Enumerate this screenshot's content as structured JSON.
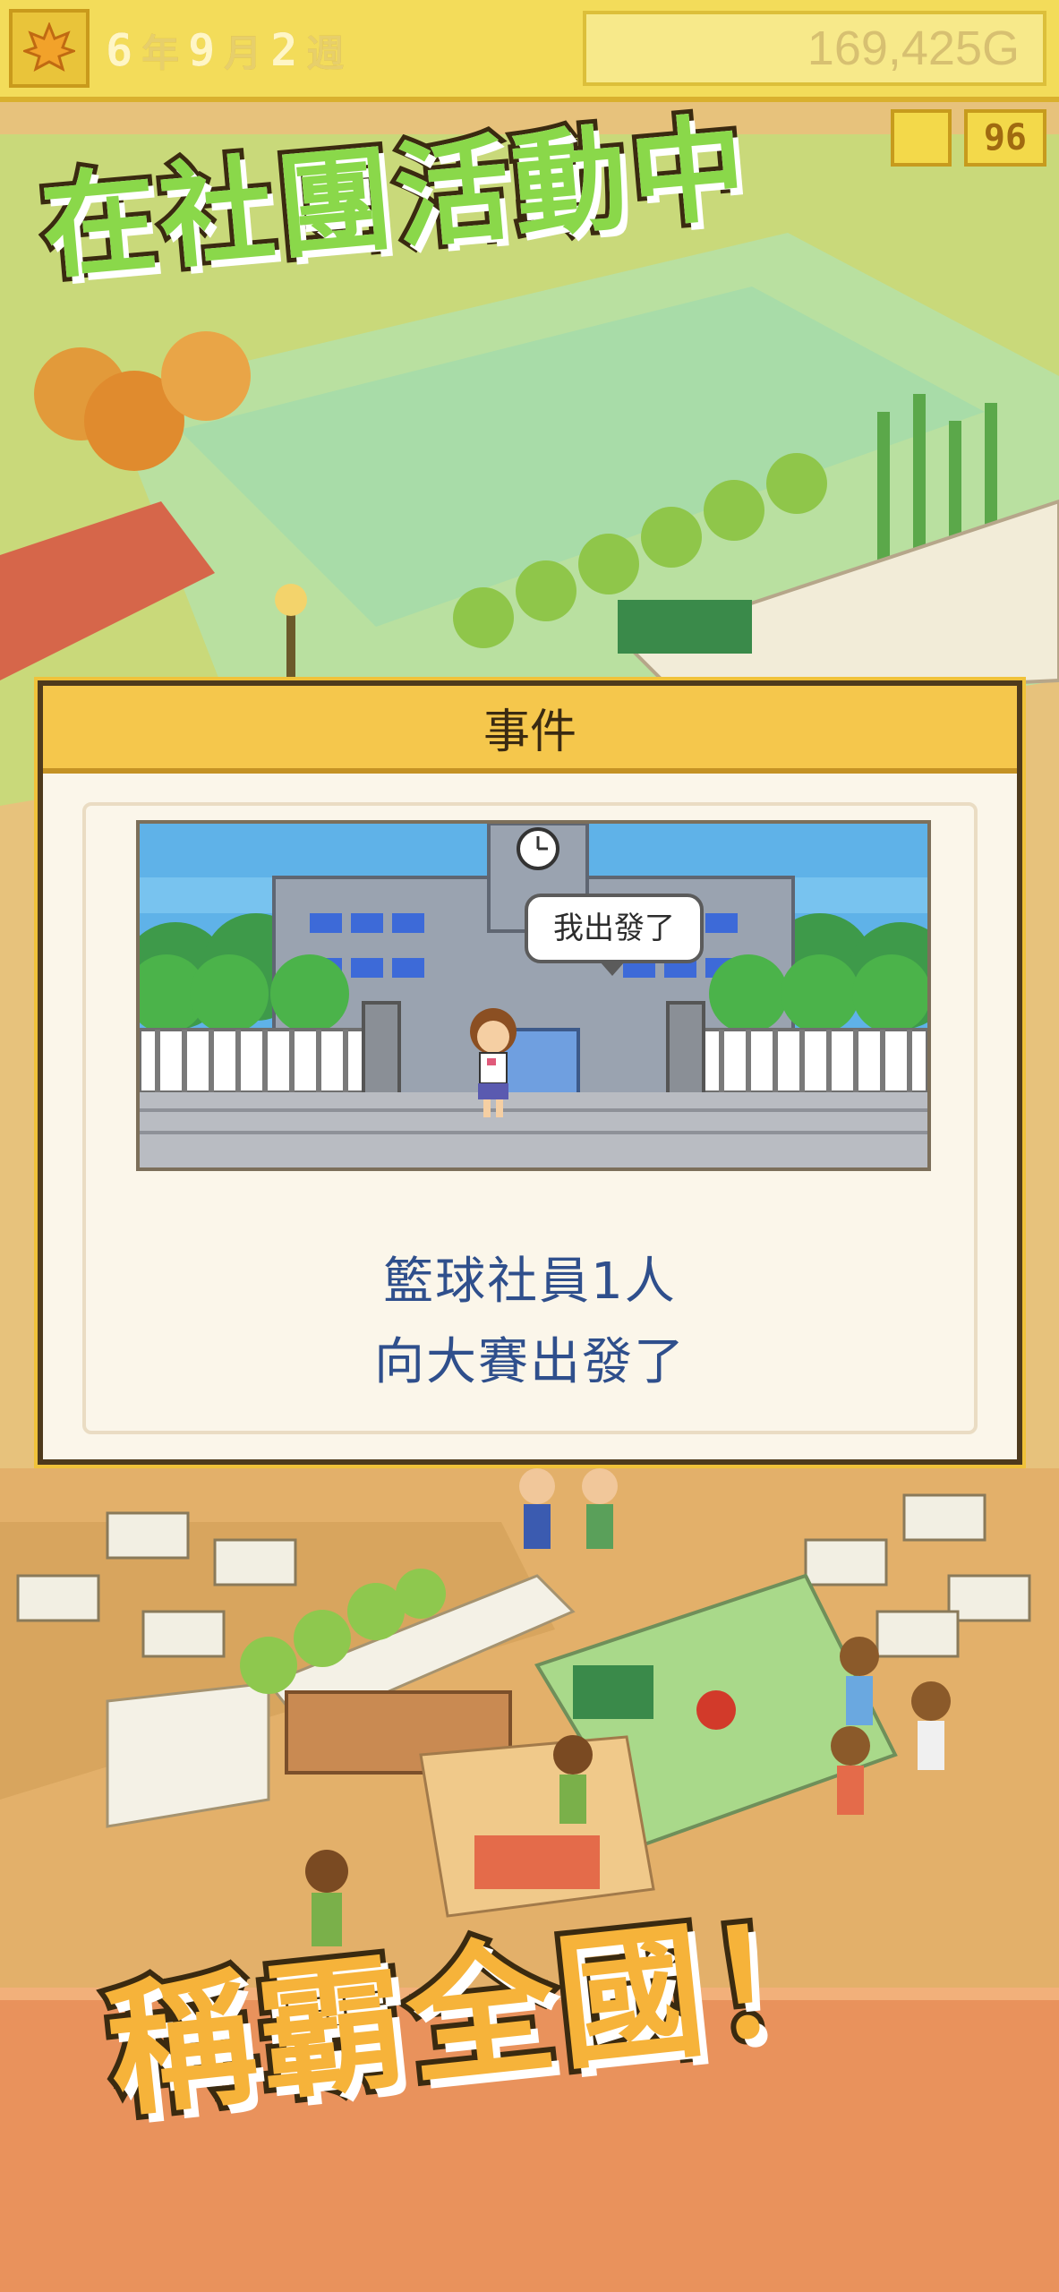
{
  "hud": {
    "season_icon": "maple-leaf-icon",
    "year": "6",
    "year_unit": "年",
    "month": "9",
    "month_unit": "月",
    "week": "2",
    "week_unit": "週",
    "money": "169,425G",
    "sub_value": "96"
  },
  "banners": {
    "top": "在社團活動中",
    "bottom": "稱霸全國！"
  },
  "dialog": {
    "title": "事件",
    "speech": "我出發了",
    "message_line1": "籃球社員1人",
    "message_line2": "向大賽出發了"
  },
  "colors": {
    "hud_bg": "#f3dc5a",
    "dialog_title_bg": "#f5c74c",
    "message_text": "#2f4f8c",
    "banner_top": "#8ad84a",
    "banner_bottom": "#f6b33a"
  }
}
